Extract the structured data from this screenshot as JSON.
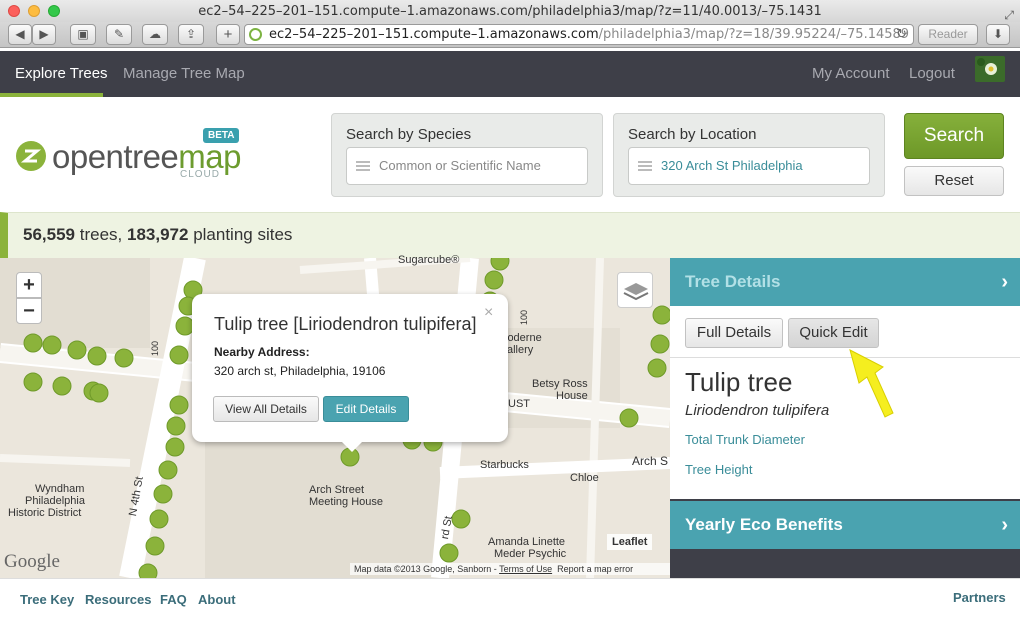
{
  "window": {
    "title": "ec2–54–225–201–151.compute–1.amazonaws.com/philadelphia3/map/?z=11/40.0013/–75.1431"
  },
  "browser": {
    "url_host": "ec2–54–225–201–151.compute–1.amazonaws.com",
    "url_path": "/philadelphia3/map/?z=18/39.95224/–75.14589",
    "reader_label": "Reader",
    "new_tab_label": "+"
  },
  "nav": {
    "explore": "Explore Trees",
    "manage": "Manage Tree Map",
    "account": "My Account",
    "logout": "Logout"
  },
  "logo": {
    "open": "opentree",
    "map": "map",
    "beta": "BETA",
    "cloud": "CLOUD"
  },
  "search": {
    "species_label": "Search by Species",
    "species_placeholder": "Common or Scientific Name",
    "location_label": "Search by Location",
    "location_value": "320 Arch St Philadelphia",
    "search_button": "Search",
    "reset_button": "Reset"
  },
  "stats": {
    "trees": "56,559",
    "trees_word": "trees,",
    "sites": "183,972",
    "sites_word": "planting sites"
  },
  "map": {
    "zoom_in": "+",
    "zoom_out": "−",
    "labels": {
      "sugarcube": "Sugarcube®",
      "moderne1": "loderne",
      "moderne2": "allery",
      "betsy1": "Betsy Ross",
      "betsy2": "House",
      "ust": "UST",
      "arch_st": "Arch S",
      "starbucks": "Starbucks",
      "chloe": "Chloe",
      "meeting1": "Arch Street",
      "meeting2": "Meeting House",
      "wyndham1": "Wyndham",
      "wyndham2": "Philadelphia",
      "wyndham3": "Historic District",
      "n4th": "N 4th St",
      "rd": "rd St",
      "amanda1": "Amanda Linette",
      "amanda2": "Meder Psychic",
      "num100a": "100",
      "num100b": "100"
    },
    "google": "Google",
    "leaflet": "Leaflet",
    "attrib_data": "Map data ©2013 Google, Sanborn -",
    "attrib_terms": "Terms of Use",
    "attrib_report": "Report a map error"
  },
  "popup": {
    "title": "Tulip tree [Liriodendron tulipifera]",
    "close": "×",
    "address_label": "Nearby Address:",
    "address": "320 arch st, Philadelphia, 19106",
    "view_all": "View All Details",
    "edit": "Edit Details"
  },
  "sidebar": {
    "details_title": "Tree Details",
    "full_details": "Full Details",
    "quick_edit": "Quick Edit",
    "tree_name": "Tulip tree",
    "scientific": "Liriodendron tulipifera",
    "trunk": "Total Trunk Diameter",
    "height": "Tree Height",
    "eco_title": "Yearly Eco Benefits",
    "chevron": "›"
  },
  "footer": {
    "tree_key": "Tree Key",
    "resources": "Resources",
    "faq": "FAQ",
    "about": "About",
    "partners": "Partners"
  },
  "colors": {
    "accent_green": "#8bb33b",
    "teal": "#4aa3b0",
    "nav_dark": "#3e3f48",
    "annotation_arrow": "#f5ee1f"
  }
}
